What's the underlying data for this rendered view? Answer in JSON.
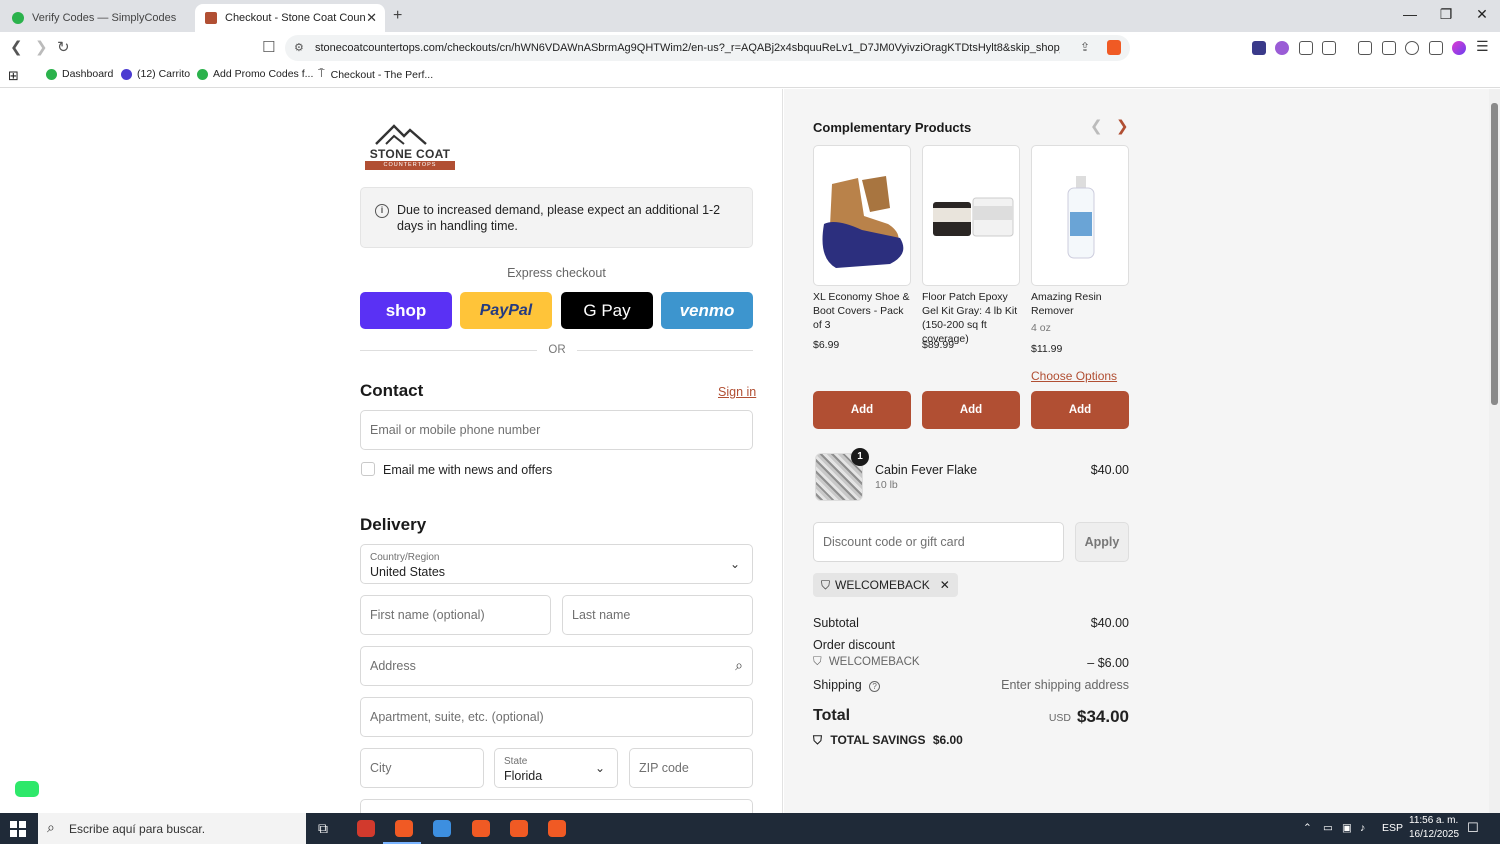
{
  "browser": {
    "tabs": [
      {
        "title": "Verify Codes — SimplyCodes",
        "active": false
      },
      {
        "title": "Checkout - Stone Coat Counterto",
        "active": true
      }
    ],
    "url": "stonecoatcountertops.com/checkouts/cn/hWN6VDAWnASbrmAg9QHTWim2/en-us?_r=AQABj2x4sbquuReLv1_D7JM0VyivziOragKTDtsHylt8&skip_shop_pa...",
    "bookmarks": [
      "Dashboard",
      "(12) Carrito",
      "Add Promo Codes f...",
      "Checkout - The Perf..."
    ]
  },
  "checkout": {
    "logo_text": "STONE COAT",
    "logo_subtext": "COUNTERTOPS",
    "notice": "Due to increased demand, please expect an additional 1-2 days in handling time.",
    "express_label": "Express checkout",
    "pay_buttons": {
      "shop": "shop",
      "paypal": "PayPal",
      "gpay": "G Pay",
      "venmo": "venmo"
    },
    "or_label": "OR",
    "contact": {
      "title": "Contact",
      "signin": "Sign in",
      "email_placeholder": "Email or mobile phone number",
      "newsletter_label": "Email me with news and offers"
    },
    "delivery": {
      "title": "Delivery",
      "country_label": "Country/Region",
      "country_value": "United States",
      "first_name_placeholder": "First name (optional)",
      "last_name_placeholder": "Last name",
      "address_placeholder": "Address",
      "apartment_placeholder": "Apartment, suite, etc. (optional)",
      "city_placeholder": "City",
      "state_label": "State",
      "state_value": "Florida",
      "zip_placeholder": "ZIP code"
    }
  },
  "summary": {
    "complementary_title": "Complementary Products",
    "products": [
      {
        "name": "XL Economy Shoe & Boot Covers - Pack of 3",
        "variant": "",
        "price": "$6.99",
        "add": "Add"
      },
      {
        "name": "Floor Patch Epoxy Gel Kit Gray: 4 lb Kit (150-200 sq ft coverage)",
        "variant": "",
        "price": "$89.99",
        "add": "Add"
      },
      {
        "name": "Amazing Resin Remover",
        "variant": "4 oz",
        "price": "$11.99",
        "add": "Add",
        "options": "Choose Options"
      }
    ],
    "cart_item": {
      "qty": "1",
      "name": "Cabin Fever Flake",
      "variant": "10 lb",
      "price": "$40.00"
    },
    "discount_placeholder": "Discount code or gift card",
    "apply_label": "Apply",
    "applied_code": "WELCOMEBACK",
    "subtotal_label": "Subtotal",
    "subtotal_value": "$40.00",
    "order_discount_label": "Order discount",
    "discount_code": "WELCOMEBACK",
    "discount_value": "– $6.00",
    "shipping_label": "Shipping",
    "shipping_value": "Enter shipping address",
    "total_label": "Total",
    "currency": "USD",
    "total_value": "$34.00",
    "savings_label": "TOTAL SAVINGS",
    "savings_value": "$6.00"
  },
  "taskbar": {
    "search_placeholder": "Escribe aquí para buscar.",
    "lang": "ESP",
    "time": "11:56 a. m.",
    "date": "16/12/2025"
  },
  "colors": {
    "accent": "#b14f33",
    "shop": "#5a31f4",
    "paypal": "#ffc439",
    "venmo": "#3d95ce"
  }
}
